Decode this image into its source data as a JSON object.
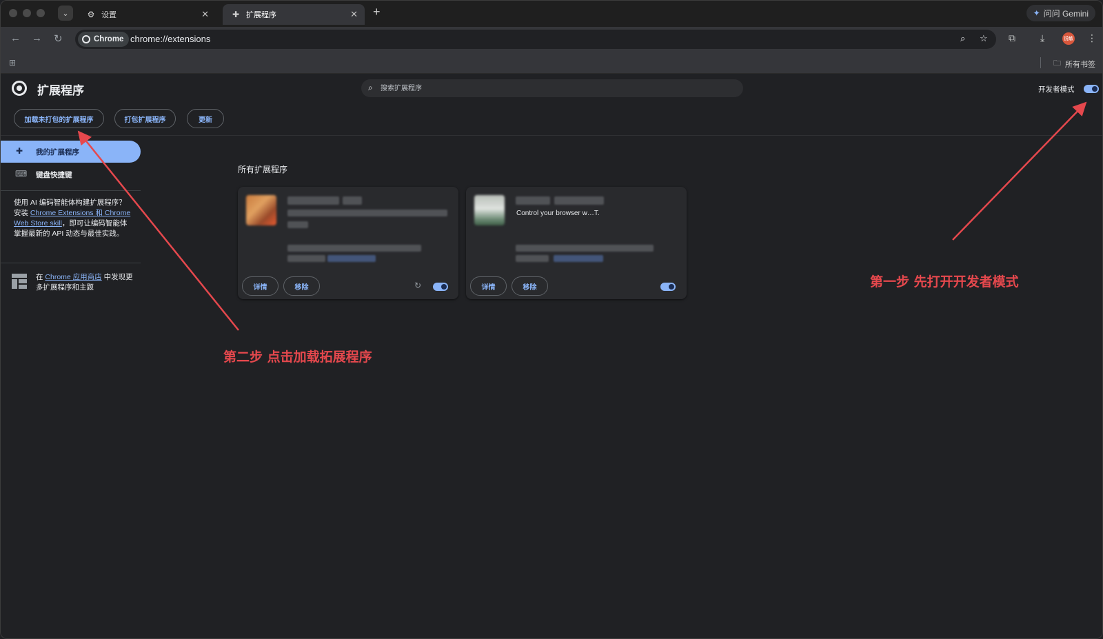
{
  "browser": {
    "tabs": [
      {
        "label": "设置",
        "icon": "gear-icon"
      },
      {
        "label": "扩展程序",
        "icon": "puzzle-icon"
      }
    ],
    "gemini_label": "问问 Gemini",
    "chip_label": "Chrome",
    "url": "chrome://extensions",
    "avatar_label": "锐敏",
    "bookmarks_all": "所有书签"
  },
  "page": {
    "title": "扩展程序",
    "search_placeholder": "搜索扩展程序",
    "dev_mode_label": "开发者模式",
    "dev_mode_on": true,
    "buttons": {
      "load_unpacked": "加载未打包的扩展程序",
      "pack": "打包扩展程序",
      "update": "更新"
    },
    "sidebar": {
      "my_extensions": "我的扩展程序",
      "shortcuts": "键盘快捷键",
      "promo_prefix": "使用 AI 编码智能体构建扩展程序？安装 ",
      "promo_link": "Chrome Extensions 和 Chrome Web Store skill",
      "promo_suffix": "，即可让编码智能体掌握最新的 API 动态与最佳实践。",
      "store_prefix": "在 ",
      "store_link": "Chrome 应用商店",
      "store_suffix": " 中发现更多扩展程序和主题"
    },
    "section_title": "所有扩展程序",
    "cards": [
      {
        "details": "详情",
        "remove": "移除",
        "enabled": true,
        "has_reload": true,
        "description": ""
      },
      {
        "details": "详情",
        "remove": "移除",
        "enabled": true,
        "has_reload": false,
        "description": "Control your browser w…T."
      }
    ]
  },
  "annotations": {
    "step1": "第一步 先打开开发者模式",
    "step2": "第二步 点击加载拓展程序"
  },
  "colors": {
    "accent": "#8ab4f8",
    "annotation": "#e5484d",
    "page_bg": "#202124",
    "card_bg": "#292a2d"
  }
}
